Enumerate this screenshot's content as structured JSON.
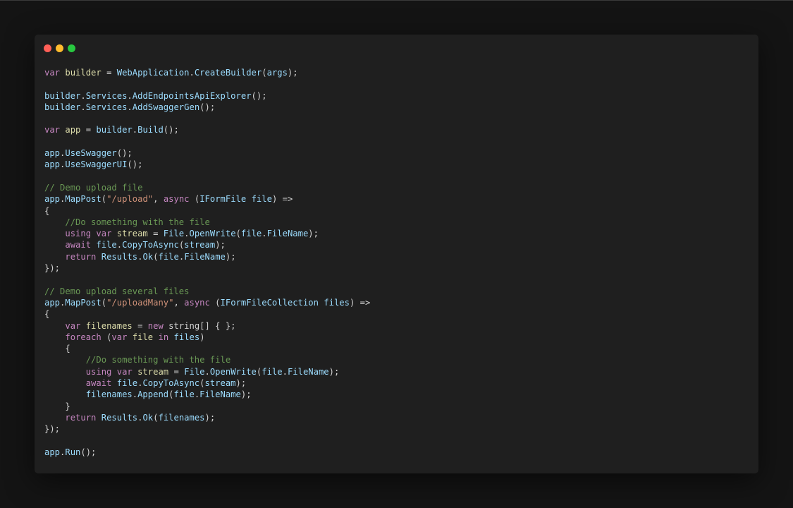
{
  "window": {
    "colors": {
      "background": "#1f1f1f",
      "page_background": "#141414",
      "close": "#ff5f57",
      "minimize": "#febc2e",
      "maximize": "#28c840"
    },
    "token_colors": {
      "kw": "#c586c0",
      "var": "#dcdcaa",
      "id": "#9cdcfe",
      "fn": "#9cdcfe",
      "str": "#ce9178",
      "cm": "#6a9955",
      "type": "#9cdcfe",
      "p": "#d4d4d4"
    }
  },
  "code": {
    "lines": [
      [
        [
          "kw",
          "var"
        ],
        [
          "p",
          " "
        ],
        [
          "var",
          "builder"
        ],
        [
          "p",
          " = "
        ],
        [
          "id",
          "WebApplication"
        ],
        [
          "p",
          "."
        ],
        [
          "fn",
          "CreateBuilder"
        ],
        [
          "p",
          "("
        ],
        [
          "id",
          "args"
        ],
        [
          "p",
          ");"
        ]
      ],
      [],
      [
        [
          "id",
          "builder"
        ],
        [
          "p",
          "."
        ],
        [
          "id",
          "Services"
        ],
        [
          "p",
          "."
        ],
        [
          "fn",
          "AddEndpointsApiExplorer"
        ],
        [
          "p",
          "();"
        ]
      ],
      [
        [
          "id",
          "builder"
        ],
        [
          "p",
          "."
        ],
        [
          "id",
          "Services"
        ],
        [
          "p",
          "."
        ],
        [
          "fn",
          "AddSwaggerGen"
        ],
        [
          "p",
          "();"
        ]
      ],
      [],
      [
        [
          "kw",
          "var"
        ],
        [
          "p",
          " "
        ],
        [
          "var",
          "app"
        ],
        [
          "p",
          " = "
        ],
        [
          "id",
          "builder"
        ],
        [
          "p",
          "."
        ],
        [
          "fn",
          "Build"
        ],
        [
          "p",
          "();"
        ]
      ],
      [],
      [
        [
          "id",
          "app"
        ],
        [
          "p",
          "."
        ],
        [
          "fn",
          "UseSwagger"
        ],
        [
          "p",
          "();"
        ]
      ],
      [
        [
          "id",
          "app"
        ],
        [
          "p",
          "."
        ],
        [
          "fn",
          "UseSwaggerUI"
        ],
        [
          "p",
          "();"
        ]
      ],
      [],
      [
        [
          "cm",
          "// Demo upload file"
        ]
      ],
      [
        [
          "id",
          "app"
        ],
        [
          "p",
          "."
        ],
        [
          "fn",
          "MapPost"
        ],
        [
          "p",
          "("
        ],
        [
          "str",
          "\"/upload\""
        ],
        [
          "p",
          ", "
        ],
        [
          "kw",
          "async"
        ],
        [
          "p",
          " ("
        ],
        [
          "type",
          "IFormFile"
        ],
        [
          "p",
          " "
        ],
        [
          "id",
          "file"
        ],
        [
          "p",
          ") =>"
        ]
      ],
      [
        [
          "p",
          "{"
        ]
      ],
      [
        [
          "p",
          "    "
        ],
        [
          "cm",
          "//Do something with the file"
        ]
      ],
      [
        [
          "p",
          "    "
        ],
        [
          "kw",
          "using"
        ],
        [
          "p",
          " "
        ],
        [
          "kw",
          "var"
        ],
        [
          "p",
          " "
        ],
        [
          "var",
          "stream"
        ],
        [
          "p",
          " = "
        ],
        [
          "id",
          "File"
        ],
        [
          "p",
          "."
        ],
        [
          "fn",
          "OpenWrite"
        ],
        [
          "p",
          "("
        ],
        [
          "id",
          "file"
        ],
        [
          "p",
          "."
        ],
        [
          "id",
          "FileName"
        ],
        [
          "p",
          ");"
        ]
      ],
      [
        [
          "p",
          "    "
        ],
        [
          "kw",
          "await"
        ],
        [
          "p",
          " "
        ],
        [
          "id",
          "file"
        ],
        [
          "p",
          "."
        ],
        [
          "fn",
          "CopyToAsync"
        ],
        [
          "p",
          "("
        ],
        [
          "id",
          "stream"
        ],
        [
          "p",
          ");"
        ]
      ],
      [
        [
          "p",
          "    "
        ],
        [
          "kw",
          "return"
        ],
        [
          "p",
          " "
        ],
        [
          "id",
          "Results"
        ],
        [
          "p",
          "."
        ],
        [
          "fn",
          "Ok"
        ],
        [
          "p",
          "("
        ],
        [
          "id",
          "file"
        ],
        [
          "p",
          "."
        ],
        [
          "id",
          "FileName"
        ],
        [
          "p",
          ");"
        ]
      ],
      [
        [
          "p",
          "});"
        ]
      ],
      [],
      [
        [
          "cm",
          "// Demo upload several files"
        ]
      ],
      [
        [
          "id",
          "app"
        ],
        [
          "p",
          "."
        ],
        [
          "fn",
          "MapPost"
        ],
        [
          "p",
          "("
        ],
        [
          "str",
          "\"/uploadMany\""
        ],
        [
          "p",
          ", "
        ],
        [
          "kw",
          "async"
        ],
        [
          "p",
          " ("
        ],
        [
          "type",
          "IFormFileCollection"
        ],
        [
          "p",
          " "
        ],
        [
          "id",
          "files"
        ],
        [
          "p",
          ") =>"
        ]
      ],
      [
        [
          "p",
          "{"
        ]
      ],
      [
        [
          "p",
          "    "
        ],
        [
          "kw",
          "var"
        ],
        [
          "p",
          " "
        ],
        [
          "var",
          "filenames"
        ],
        [
          "p",
          " = "
        ],
        [
          "kw",
          "new"
        ],
        [
          "p",
          " string[] { };"
        ]
      ],
      [
        [
          "p",
          "    "
        ],
        [
          "kw",
          "foreach"
        ],
        [
          "p",
          " ("
        ],
        [
          "kw",
          "var"
        ],
        [
          "p",
          " "
        ],
        [
          "var",
          "file"
        ],
        [
          "p",
          " "
        ],
        [
          "kw",
          "in"
        ],
        [
          "p",
          " "
        ],
        [
          "id",
          "files"
        ],
        [
          "p",
          ")"
        ]
      ],
      [
        [
          "p",
          "    {"
        ]
      ],
      [
        [
          "p",
          "        "
        ],
        [
          "cm",
          "//Do something with the file"
        ]
      ],
      [
        [
          "p",
          "        "
        ],
        [
          "kw",
          "using"
        ],
        [
          "p",
          " "
        ],
        [
          "kw",
          "var"
        ],
        [
          "p",
          " "
        ],
        [
          "var",
          "stream"
        ],
        [
          "p",
          " = "
        ],
        [
          "id",
          "File"
        ],
        [
          "p",
          "."
        ],
        [
          "fn",
          "OpenWrite"
        ],
        [
          "p",
          "("
        ],
        [
          "id",
          "file"
        ],
        [
          "p",
          "."
        ],
        [
          "id",
          "FileName"
        ],
        [
          "p",
          ");"
        ]
      ],
      [
        [
          "p",
          "        "
        ],
        [
          "kw",
          "await"
        ],
        [
          "p",
          " "
        ],
        [
          "id",
          "file"
        ],
        [
          "p",
          "."
        ],
        [
          "fn",
          "CopyToAsync"
        ],
        [
          "p",
          "("
        ],
        [
          "id",
          "stream"
        ],
        [
          "p",
          ");"
        ]
      ],
      [
        [
          "p",
          "        "
        ],
        [
          "id",
          "filenames"
        ],
        [
          "p",
          "."
        ],
        [
          "fn",
          "Append"
        ],
        [
          "p",
          "("
        ],
        [
          "id",
          "file"
        ],
        [
          "p",
          "."
        ],
        [
          "id",
          "FileName"
        ],
        [
          "p",
          ");"
        ]
      ],
      [
        [
          "p",
          "    }"
        ]
      ],
      [
        [
          "p",
          "    "
        ],
        [
          "kw",
          "return"
        ],
        [
          "p",
          " "
        ],
        [
          "id",
          "Results"
        ],
        [
          "p",
          "."
        ],
        [
          "fn",
          "Ok"
        ],
        [
          "p",
          "("
        ],
        [
          "id",
          "filenames"
        ],
        [
          "p",
          ");"
        ]
      ],
      [
        [
          "p",
          "});"
        ]
      ],
      [],
      [
        [
          "id",
          "app"
        ],
        [
          "p",
          "."
        ],
        [
          "fn",
          "Run"
        ],
        [
          "p",
          "();"
        ]
      ]
    ]
  }
}
